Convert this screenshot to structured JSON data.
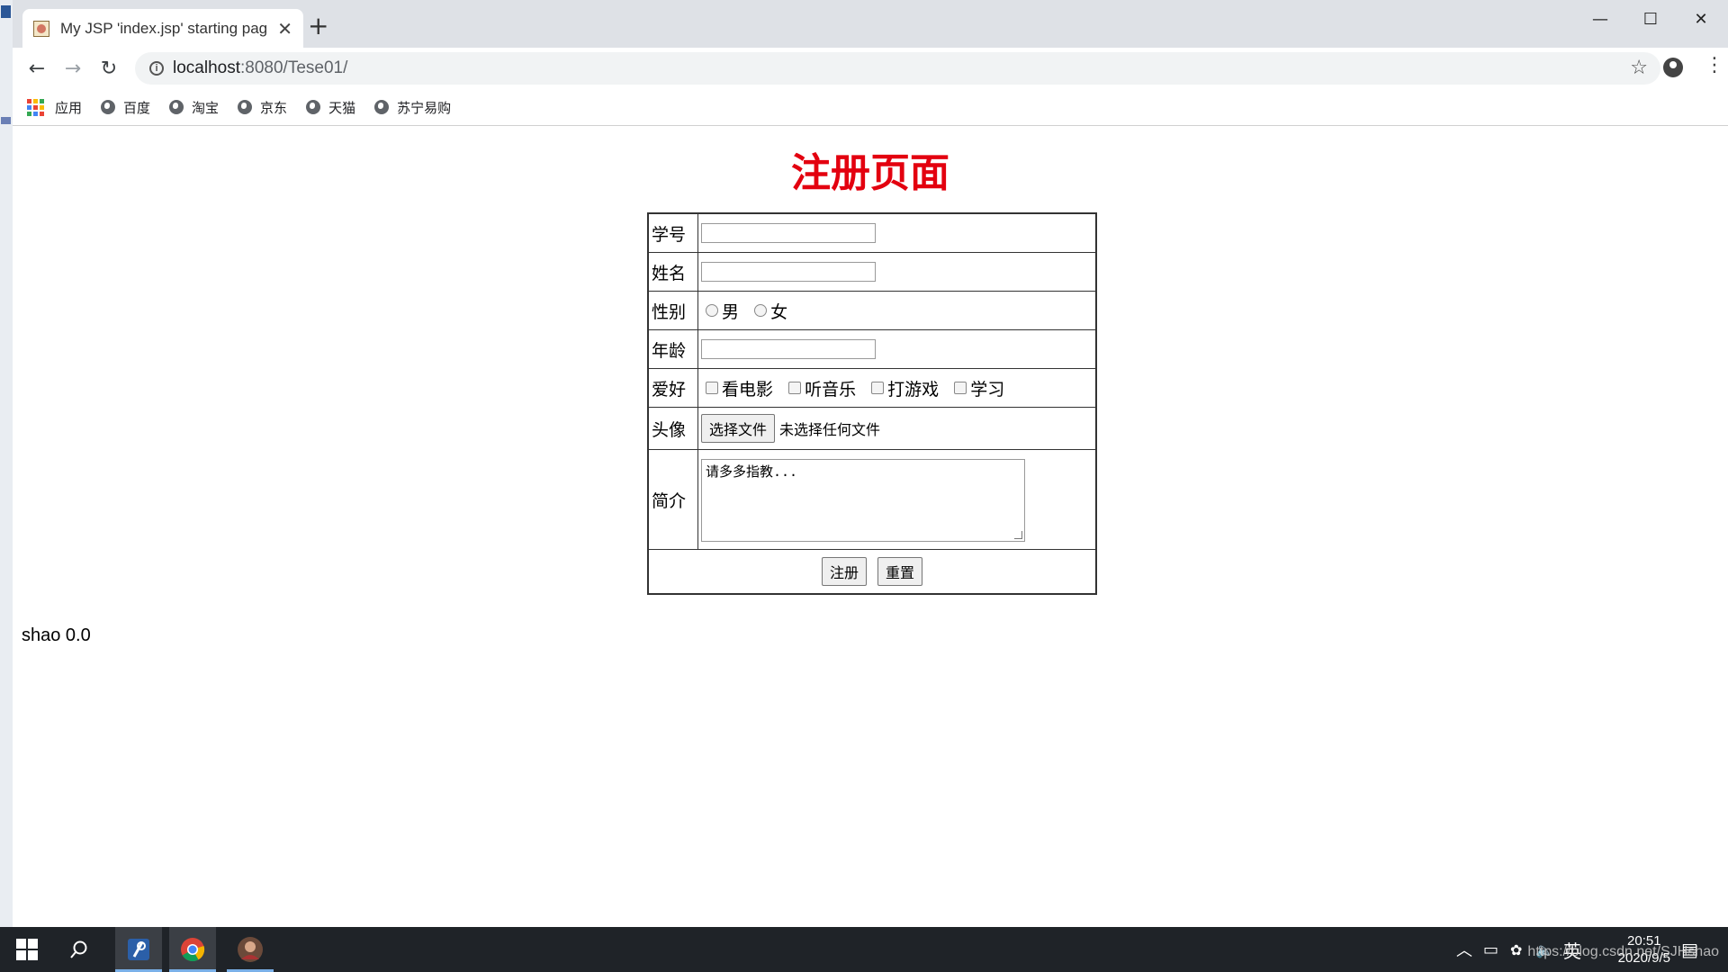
{
  "browser": {
    "tab_title": "My JSP 'index.jsp' starting pag",
    "url_host": "localhost",
    "url_rest": ":8080/Tese01/",
    "bookmarks": [
      "应用",
      "百度",
      "淘宝",
      "京东",
      "天猫",
      "苏宁易购"
    ]
  },
  "page": {
    "title": "注册页面",
    "form": {
      "student_id_label": "学号",
      "name_label": "姓名",
      "gender_label": "性别",
      "gender_options": [
        "男",
        "女"
      ],
      "age_label": "年龄",
      "hobby_label": "爱好",
      "hobby_options": [
        "看电影",
        "听音乐",
        "打游戏",
        "学习"
      ],
      "avatar_label": "头像",
      "file_button": "选择文件",
      "file_status": "未选择任何文件",
      "intro_label": "简介",
      "intro_text": "请多多指教...",
      "submit_label": "注册",
      "reset_label": "重置"
    },
    "footer_text": "shao 0.0"
  },
  "taskbar": {
    "ime": "英",
    "time": "20:51",
    "date": "2020/9/5",
    "watermark": "https://blog.csdn.net/SJHshao",
    "taskbar_icons": [
      "windows-start",
      "search",
      "eclipse",
      "chrome",
      "avatar-app"
    ]
  }
}
